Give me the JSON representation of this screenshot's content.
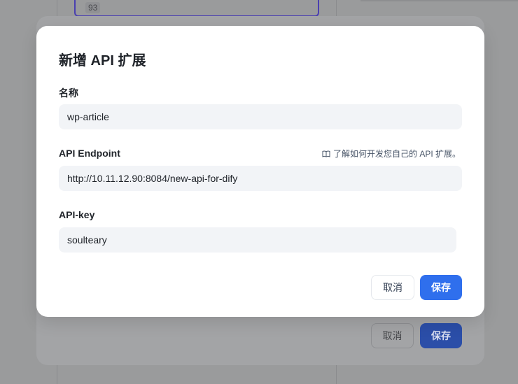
{
  "background": {
    "card_count": "93",
    "cancel_label": "取消",
    "save_label": "保存"
  },
  "dialog": {
    "title": "新增 API 扩展",
    "fields": {
      "name": {
        "label": "名称",
        "value": "wp-article"
      },
      "endpoint": {
        "label": "API Endpoint",
        "value": "http://10.11.12.90:8084/new-api-for-dify"
      },
      "api_key": {
        "label": "API-key",
        "value": "soulteary"
      }
    },
    "doc_link": {
      "icon": "book-icon",
      "text": "了解如何开发您自己的 API 扩展。"
    },
    "buttons": {
      "cancel_label": "取消",
      "save_label": "保存"
    }
  },
  "colors": {
    "primary": "#2f6fed",
    "input_bg": "#f2f4f7",
    "overlay": "#9a9b9c"
  }
}
